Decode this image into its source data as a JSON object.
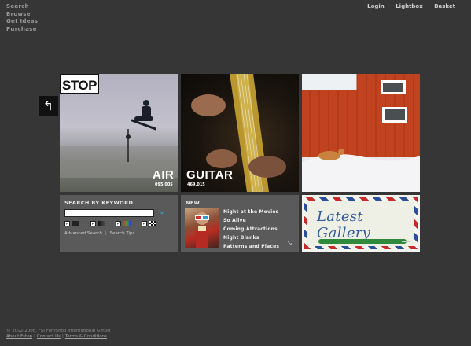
{
  "left_nav": [
    "Search",
    "Browse",
    "Get Ideas",
    "Purchase"
  ],
  "top_nav": [
    "Login",
    "Lightbox",
    "Basket"
  ],
  "logo": "STOP",
  "tiles": {
    "air": {
      "title": "AIR",
      "count": "095.005"
    },
    "guitar": {
      "title": "GUITAR",
      "count": "469.015"
    }
  },
  "search": {
    "heading": "SEARCH BY KEYWORD",
    "input_value": "",
    "advanced_label": "Advanced Search",
    "separator": "|",
    "tips_label": "Search Tips"
  },
  "new_panel": {
    "heading": "NEW",
    "items": [
      "Night at the Movies",
      "So Alive",
      "Coming Attractions",
      "Night Blanks",
      "Patterns and Places"
    ]
  },
  "gallery": {
    "title": "Latest Gallery"
  },
  "footer": {
    "copyright": "© 2002-2008, FSI FontShop International GmbH",
    "links": [
      "About Fstop",
      "Contact Us",
      "Terms & Conditions"
    ],
    "separator": "|"
  },
  "colors": {
    "background": "#363636",
    "panel": "#5a5a5a",
    "accent_blue": "#35a3c9"
  }
}
